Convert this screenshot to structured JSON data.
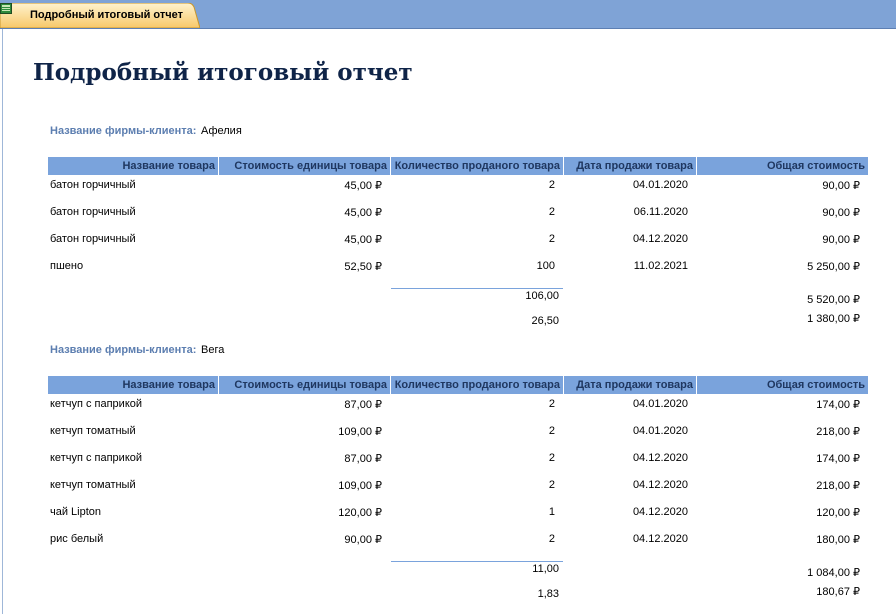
{
  "tab": {
    "label": "Подробный итоговый отчет"
  },
  "report": {
    "title": "Подробный итоговый отчет",
    "group_label": "Название фирмы-клиента:",
    "columns": [
      "Название товара",
      "Стоимость единицы товара",
      "Количество проданого товара",
      "Дата продажи товара",
      "Общая стоимость"
    ],
    "groups": [
      {
        "client": "Афелия",
        "rows": [
          [
            "батон горчичный",
            "45,00 ₽",
            "2",
            "04.01.2020",
            "90,00 ₽"
          ],
          [
            "батон горчичный",
            "45,00 ₽",
            "2",
            "06.11.2020",
            "90,00 ₽"
          ],
          [
            "батон горчичный",
            "45,00 ₽",
            "2",
            "04.12.2020",
            "90,00 ₽"
          ],
          [
            "пшено",
            "52,50 ₽",
            "100",
            "11.02.2021",
            "5 250,00 ₽"
          ]
        ],
        "qty_sum": "106,00",
        "total_sum": "5 520,00 ₽",
        "qty_avg": "26,50",
        "total_avg": "1 380,00 ₽"
      },
      {
        "client": "Вега",
        "rows": [
          [
            "кетчуп с паприкой",
            "87,00 ₽",
            "2",
            "04.01.2020",
            "174,00 ₽"
          ],
          [
            "кетчуп томатный",
            "109,00 ₽",
            "2",
            "04.01.2020",
            "218,00 ₽"
          ],
          [
            "кетчуп с паприкой",
            "87,00 ₽",
            "2",
            "04.12.2020",
            "174,00 ₽"
          ],
          [
            "кетчуп томатный",
            "109,00 ₽",
            "2",
            "04.12.2020",
            "218,00 ₽"
          ],
          [
            "чай Lipton",
            "120,00 ₽",
            "1",
            "04.12.2020",
            "120,00 ₽"
          ],
          [
            "рис белый",
            "90,00 ₽",
            "2",
            "04.12.2020",
            "180,00 ₽"
          ]
        ],
        "qty_sum": "11,00",
        "total_sum": "1 084,00 ₽",
        "qty_avg": "1,83",
        "total_avg": "180,67 ₽"
      }
    ]
  }
}
